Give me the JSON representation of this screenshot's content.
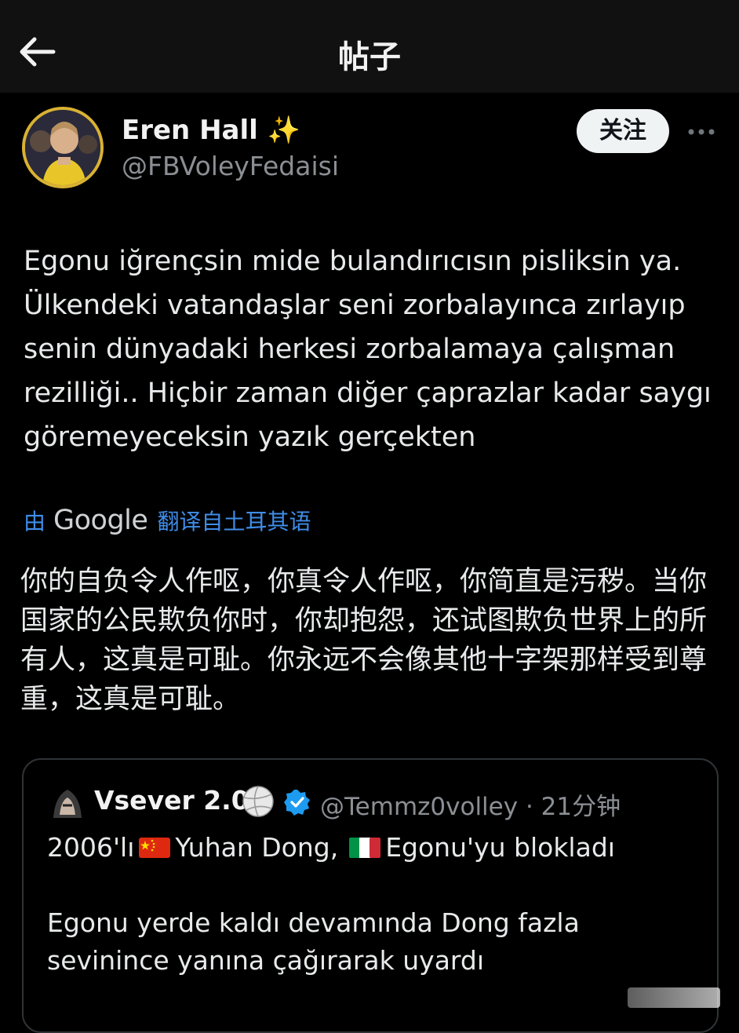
{
  "header": {
    "title": "帖子"
  },
  "post": {
    "author_name": "Eren Hall",
    "author_emoji": "✨",
    "author_handle": "@FBVoleyFedaisi",
    "follow_label": "关注",
    "text": "Egonu iğrençsin mide bulandırıcısın pisliksin ya. Ülkendeki vatandaşlar seni zorbalayınca zırlayıp senin dünyadaki herkesi zorbalamaya çalışman rezilliği.. Hiçbir zaman diğer çaprazlar kadar saygı göremeyeceksin yazık gerçekten",
    "translation": {
      "prefix": "由",
      "provider": "Google",
      "suffix": "翻译自土耳其语",
      "text": "你的自负令人作呕，你真令人作呕，你简直是污秽。当你国家的公民欺负你时，你却抱怨，还试图欺负世界上的所有人，这真是可耻。你永远不会像其他十字架那样受到尊重，这真是可耻。"
    }
  },
  "quote": {
    "name": "Vsever 2.0",
    "handle_time": "@Temmz0volley · 21分钟",
    "line1_start": "2006'lı",
    "line1_mid": "Yuhan Dong,",
    "line1_end": "Egonu'yu blokladı",
    "body": "Egonu yerde kaldı devamında Dong fazla sevinince yanına çağırarak uyardı"
  },
  "colors": {
    "background": "#000000",
    "link_blue": "#3f8de8",
    "muted": "#8b8f94",
    "verified_blue": "#1d9bf0"
  },
  "icons": [
    "back-arrow-icon",
    "sparkles-icon",
    "more-icon",
    "volleyball-icon",
    "verified-icon",
    "china-flag-icon",
    "italy-flag-icon"
  ]
}
